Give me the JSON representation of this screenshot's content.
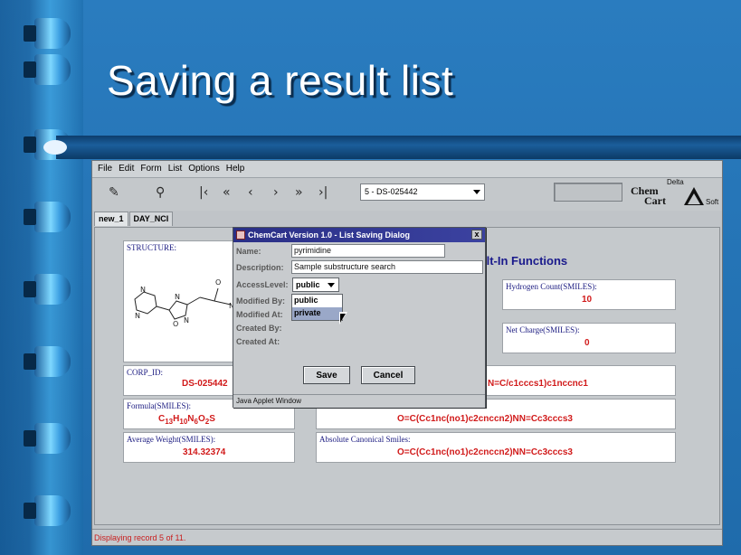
{
  "slide": {
    "title": "Saving a result list"
  },
  "menu": [
    "File",
    "Edit",
    "Form",
    "List",
    "Options",
    "Help"
  ],
  "toolbar": {
    "icons": [
      "edit-icon",
      "binoculars-icon",
      "first-record-icon",
      "rewind-icon",
      "previous-icon",
      "next-icon",
      "fast-forward-icon",
      "last-record-icon"
    ],
    "record_select": "5 - DS-025442"
  },
  "logo": {
    "chem": "Chem",
    "cart": "Cart",
    "delta": "Delta",
    "soft": "Soft"
  },
  "tabs": [
    "new_1",
    "DAY_NCI"
  ],
  "panels": {
    "structure_label": "STRUCTURE:",
    "functions_title": "ilt-In Functions",
    "hydrogen_label": "Hydrogen Count(SMILES):",
    "hydrogen_value": "10",
    "net_charge_label": "Net Charge(SMILES):",
    "net_charge_value": "0",
    "corp_id_label": "CORP_ID:",
    "corp_id_value": "DS-025442",
    "smiles_partial": "N=C/c1cccs1)c1nccnc1",
    "formula_label": "Formula(SMILES):",
    "formula_value": {
      "c": "C",
      "c_n": "13",
      "h": "H",
      "h_n": "10",
      "n": "N",
      "n_n": "6",
      "o": "O",
      "o_n": "2",
      "s": "S"
    },
    "canonical_value": "O=C(Cc1nc(no1)c2cnccn2)NN=Cc3cccs3",
    "avg_weight_label": "Average Weight(SMILES):",
    "avg_weight_value": "314.32374",
    "abs_canonical_label": "Absolute Canonical Smiles:",
    "abs_canonical_value": "O=C(Cc1nc(no1)c2cnccn2)NN=Cc3cccs3"
  },
  "status": "Displaying record 5 of 11.",
  "dialog": {
    "title": "ChemCart Version 1.0 - List Saving Dialog",
    "close": "x",
    "name_label": "Name:",
    "name_value": "pyrimidine",
    "description_label": "Description:",
    "description_value": "Sample substructure search",
    "access_label": "AccessLevel:",
    "access_value": "public",
    "access_options": [
      "public",
      "private"
    ],
    "modified_by_label": "Modified By:",
    "modified_at_label": "Modified At:",
    "created_by_label": "Created By:",
    "created_at_label": "Created At:",
    "save_label": "Save",
    "cancel_label": "Cancel",
    "footer": "Java Applet Window"
  }
}
